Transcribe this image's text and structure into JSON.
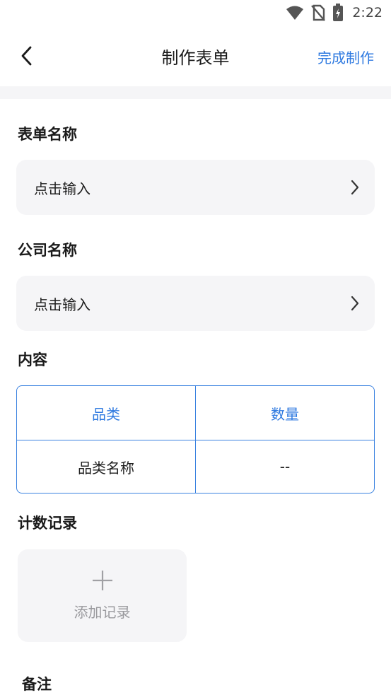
{
  "status_bar": {
    "time": "2:22",
    "icons": [
      "wifi-icon",
      "no-sim-icon",
      "battery-charging-icon"
    ]
  },
  "nav": {
    "back_icon": "chevron-left-icon",
    "title": "制作表单",
    "action": "完成制作"
  },
  "form_name": {
    "label": "表单名称",
    "placeholder": "点击输入",
    "icon": "chevron-right-icon"
  },
  "company_name": {
    "label": "公司名称",
    "placeholder": "点击输入",
    "icon": "chevron-right-icon"
  },
  "content": {
    "label": "内容",
    "columns": [
      "品类",
      "数量"
    ],
    "rows": [
      [
        "品类名称",
        "--"
      ]
    ]
  },
  "count_record": {
    "label": "计数记录",
    "add_label": "添加记录",
    "icon": "plus-icon"
  },
  "remarks": {
    "label": "备注"
  },
  "colors": {
    "accent": "#2f7ae0",
    "field_bg": "#f5f5f7",
    "table_border": "#3a82e0",
    "muted_text": "#9a9a9e"
  }
}
